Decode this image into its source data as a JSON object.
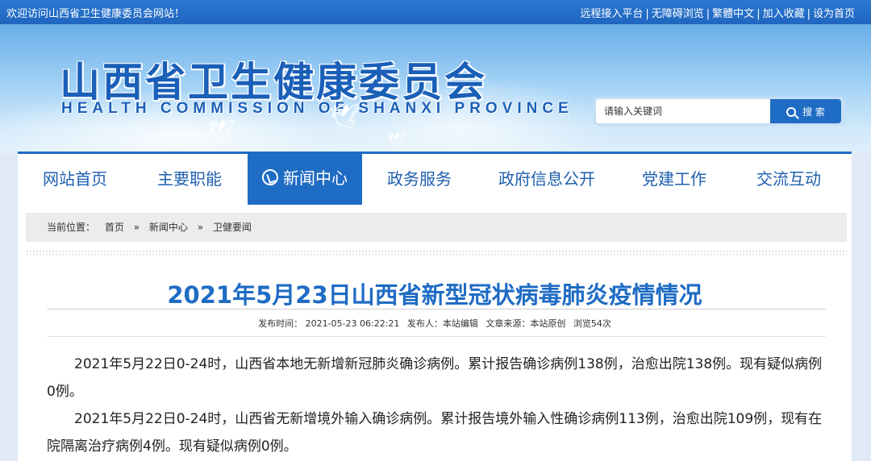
{
  "topbar": {
    "welcome": "欢迎访问山西省卫生健康委员会网站！",
    "links": [
      "远程接入平台",
      "无障碍浏览",
      "繁體中文",
      "加入收藏",
      "设为首页"
    ],
    "separator": "|"
  },
  "header": {
    "title": "山西省卫生健康委员会",
    "subtitle": "HEALTH COMMISSION OF SHANXI PROVINCE"
  },
  "search": {
    "placeholder": "请输入关键词",
    "button_label": "搜 索"
  },
  "nav": {
    "tabs": [
      {
        "label": "网站首页"
      },
      {
        "label": "主要职能"
      },
      {
        "label": "新闻中心"
      },
      {
        "label": "政务服务"
      },
      {
        "label": "政府信息公开"
      },
      {
        "label": "党建工作"
      },
      {
        "label": "交流互动"
      }
    ],
    "active_index": 2
  },
  "breadcrumb": {
    "prefix": "当前位置：",
    "items": [
      "首页",
      "新闻中心",
      "卫健要闻"
    ],
    "separator": "»"
  },
  "article": {
    "title": "2021年5月23日山西省新型冠状病毒肺炎疫情情况",
    "meta": {
      "published": "发布时间： 2021-05-23 06:22:21",
      "publisher": "发布人：本站编辑",
      "source": "文章来源：本站原创",
      "views": "浏览54次"
    },
    "paragraphs": [
      "2021年5月22日0-24时，山西省本地无新增新冠肺炎确诊病例。累计报告确诊病例138例，治愈出院138例。现有疑似病例0例。",
      "2021年5月22日0-24时，山西省无新增境外输入确诊病例。累计报告境外输入性确诊病例113例，治愈出院109例，现有在院隔离治疗病例4例。现有疑似病例0例。"
    ]
  },
  "colors": {
    "brand_blue": "#1f6cc4",
    "title_blue": "#1f6cc4",
    "topbar_blue": "#2a78d2"
  }
}
